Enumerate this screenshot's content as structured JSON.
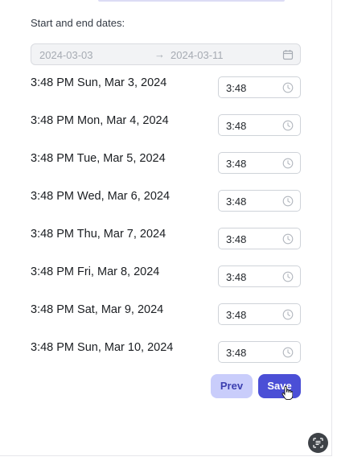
{
  "form": {
    "dates_label": "Start and end dates:",
    "range": {
      "start": "2024-03-03",
      "arrow": "→",
      "end": "2024-03-11",
      "icon": "calendar-icon"
    },
    "rows": [
      {
        "label": "3:48 PM Sun, Mar 3, 2024",
        "time": "3:48"
      },
      {
        "label": "3:48 PM Mon, Mar 4, 2024",
        "time": "3:48"
      },
      {
        "label": "3:48 PM Tue, Mar 5, 2024",
        "time": "3:48"
      },
      {
        "label": "3:48 PM Wed, Mar 6, 2024",
        "time": "3:48"
      },
      {
        "label": "3:48 PM Thu, Mar 7, 2024",
        "time": "3:48"
      },
      {
        "label": "3:48 PM Fri, Mar 8, 2024",
        "time": "3:48"
      },
      {
        "label": "3:48 PM Sat, Mar 9, 2024",
        "time": "3:48"
      },
      {
        "label": "3:48 PM Sun, Mar 10, 2024",
        "time": "3:48"
      }
    ]
  },
  "buttons": {
    "prev_label": "Prev",
    "save_label": "Save"
  },
  "icons": {
    "time_icon": "clock-icon",
    "fab_icon": "scan-text-icon",
    "cursor": "hand-pointer-icon"
  },
  "colors": {
    "primary": "#4b4fd6",
    "secondary": "#c9cdfb",
    "fab": "#3e4247"
  }
}
